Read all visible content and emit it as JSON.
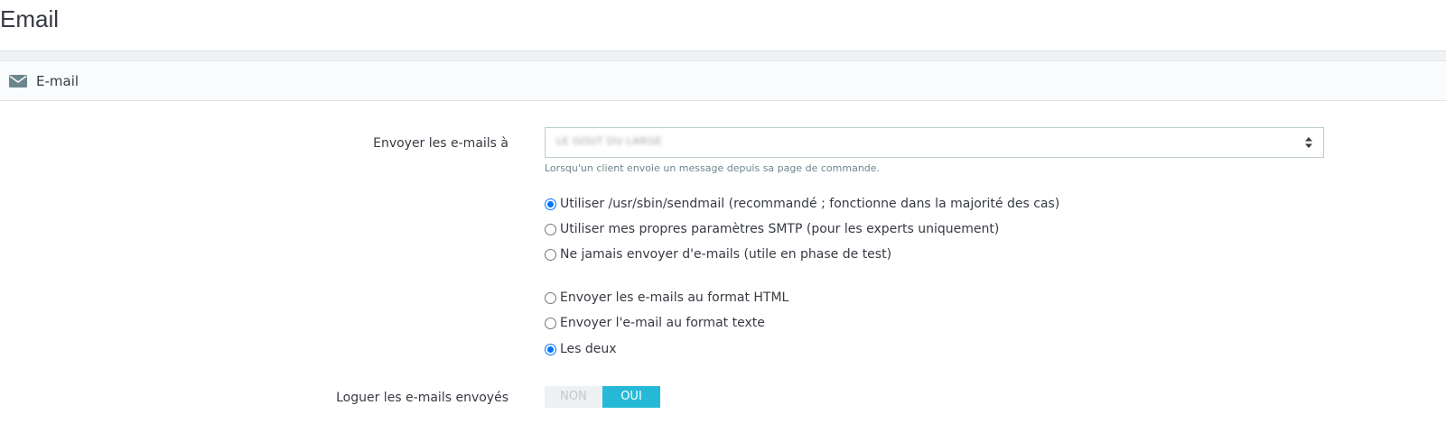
{
  "page": {
    "title": "Email"
  },
  "panel": {
    "heading_icon": "envelope-icon",
    "heading": "E-mail"
  },
  "send_to": {
    "label": "Envoyer les e-mails à",
    "selected_value": "LE GOUT DU LARGE",
    "help": "Lorsqu'un client envoie un message depuis sa page de commande."
  },
  "method": {
    "options": [
      {
        "label": "Utiliser /usr/sbin/sendmail (recommandé ; fonctionne dans la majorité des cas)",
        "checked": true
      },
      {
        "label": "Utiliser mes propres paramètres SMTP (pour les experts uniquement)",
        "checked": false
      },
      {
        "label": "Ne jamais envoyer d'e-mails (utile en phase de test)",
        "checked": false
      }
    ]
  },
  "format": {
    "options": [
      {
        "label": "Envoyer les e-mails au format HTML",
        "checked": false
      },
      {
        "label": "Envoyer l'e-mail au format texte",
        "checked": false
      },
      {
        "label": "Les deux",
        "checked": true
      }
    ]
  },
  "log_emails": {
    "label": "Loguer les e-mails envoyés",
    "off_label": "NON",
    "on_label": "OUI",
    "value": "OUI"
  },
  "colors": {
    "accent": "#25b9d7",
    "radio_checked": "#0075ff",
    "help_text": "#6c868e"
  }
}
